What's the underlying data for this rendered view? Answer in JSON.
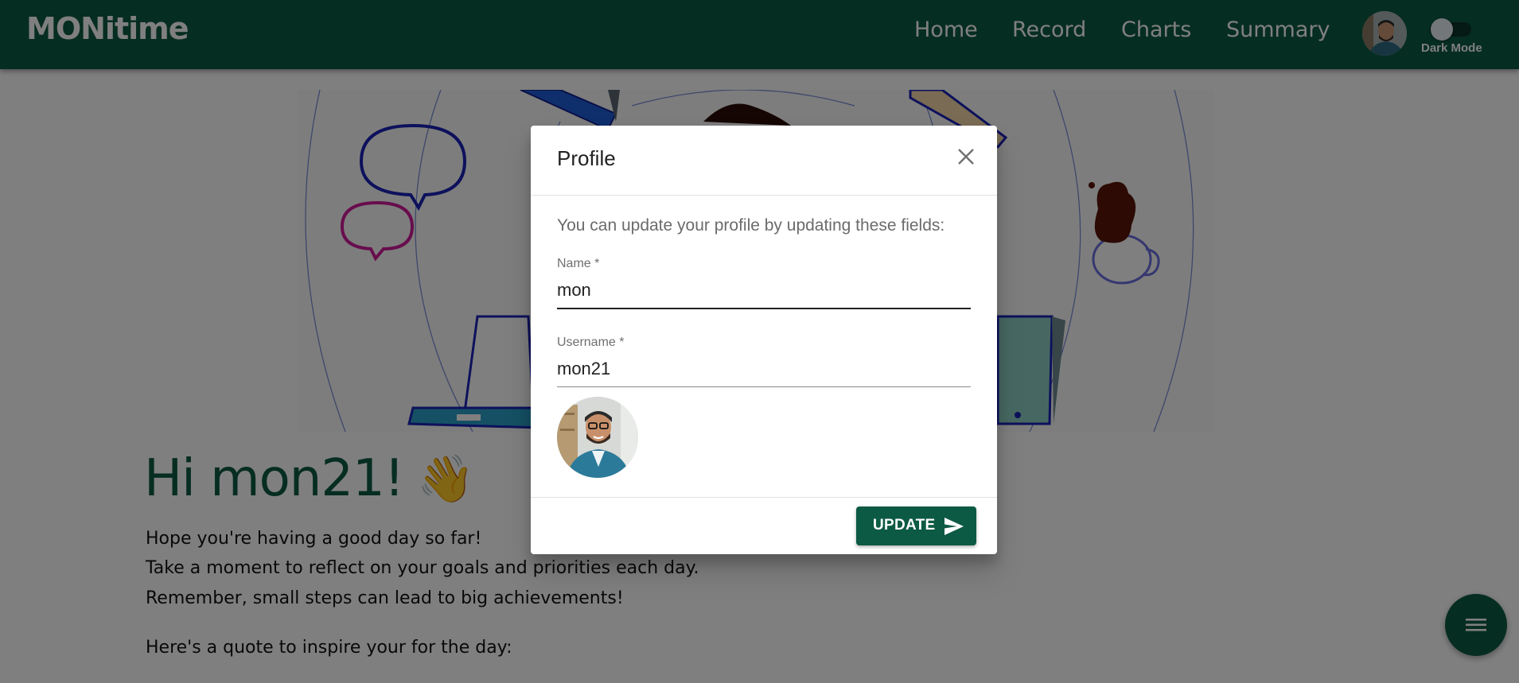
{
  "app": {
    "logo": "MONitime",
    "nav": [
      {
        "label": "Home"
      },
      {
        "label": "Record"
      },
      {
        "label": "Charts"
      },
      {
        "label": "Summary"
      }
    ],
    "dark_mode_label": "Dark Mode",
    "dark_mode_on": false
  },
  "page": {
    "greeting": "Hi mon21!",
    "greeting_emoji": "👋",
    "messages": [
      "Hope you're having a good day so far!",
      "Take a moment to reflect on your goals and priorities each day.",
      "Remember, small steps can lead to big achievements!"
    ],
    "quote_intro": "Here's a quote to inspire your for the day:"
  },
  "dialog": {
    "title": "Profile",
    "intro": "You can update your profile by updating these fields:",
    "name_label": "Name *",
    "name_value": "mon",
    "username_label": "Username *",
    "username_value": "mon21",
    "update_label": "UPDATE"
  },
  "icons": {
    "close": "close-icon",
    "send": "send-icon",
    "menu": "menu-icon"
  },
  "colors": {
    "primary": "#0c5a43",
    "backdrop": "rgba(0,0,0,0.5)"
  }
}
